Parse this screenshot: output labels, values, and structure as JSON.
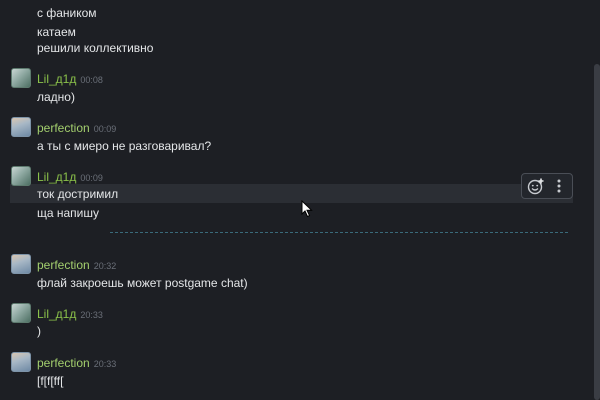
{
  "messages": {
    "top_partial": "с фаником",
    "top_line2": "катаем",
    "top_line3": "решили коллективно",
    "m1": {
      "author": "Lil_д1д",
      "time": "00:08",
      "lines": [
        "ладно)"
      ]
    },
    "m2": {
      "author": "perfection",
      "time": "00:09",
      "lines": [
        "а ты с миеро не разговаривал?"
      ]
    },
    "m3": {
      "author": "Lil_д1д",
      "time": "00:09",
      "lines": [
        "ток достримил",
        "ща напишу"
      ]
    },
    "m4": {
      "author": "perfection",
      "time": "20:32",
      "lines": [
        "флай закроешь может postgame chat)"
      ]
    },
    "m5": {
      "author": "Lil_д1д",
      "time": "20:33",
      "lines": [
        ")"
      ]
    },
    "m6": {
      "author": "perfection",
      "time": "20:33",
      "lines": [
        "[f[f[ff["
      ]
    }
  },
  "actions": {
    "emoji_icon": "emoji-add-icon",
    "more_icon": "vertical-dots-icon"
  },
  "colors": {
    "background": "#1d1f24",
    "author_lil": "#8bc24a",
    "author_perfection": "#a3cf6e",
    "timestamp": "#6a6f78",
    "divider": "#3a6a7a"
  }
}
